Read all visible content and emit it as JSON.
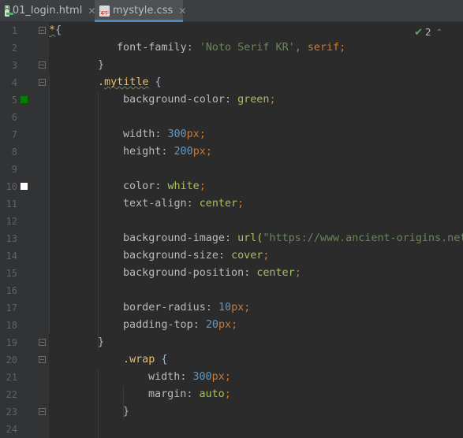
{
  "tabs": [
    {
      "label": "01_login.html",
      "icon": "html-file-icon",
      "icon_text": "H",
      "active": false
    },
    {
      "label": "mystyle.css",
      "icon": "css-file-icon",
      "icon_text": "CSS",
      "active": true
    }
  ],
  "inspection": {
    "icon": "check-icon",
    "count": "2"
  },
  "line_numbers": [
    "1",
    "2",
    "3",
    "4",
    "5",
    "6",
    "7",
    "8",
    "9",
    "10",
    "11",
    "12",
    "13",
    "14",
    "15",
    "16",
    "17",
    "18",
    "19",
    "20",
    "21",
    "22",
    "23",
    "24"
  ],
  "color_markers": {
    "line5": "#008000",
    "line10": "#ffffff"
  },
  "code": {
    "l1": {
      "sel": "*",
      "brace": "{"
    },
    "l2": {
      "prop": "font-family",
      "colon": ": ",
      "str": "'Noto Serif KR'",
      "comma": ", ",
      "kw": "serif",
      "semi": ";"
    },
    "l3": {
      "brace": "}"
    },
    "l4": {
      "dot": ".",
      "cls": "mytitle",
      "brace": " {"
    },
    "l5": {
      "prop": "background-color",
      "colon": ": ",
      "val": "green",
      "semi": ";"
    },
    "l7": {
      "prop": "width",
      "colon": ": ",
      "num": "300",
      "unit": "px",
      "semi": ";"
    },
    "l8": {
      "prop": "height",
      "colon": ": ",
      "num": "200",
      "unit": "px",
      "semi": ";"
    },
    "l10": {
      "prop": "color",
      "colon": ": ",
      "val": "white",
      "semi": ";"
    },
    "l11": {
      "prop": "text-align",
      "colon": ": ",
      "val": "center",
      "semi": ";"
    },
    "l13": {
      "prop": "background-image",
      "colon": ": ",
      "fn": "url(",
      "str": "\"https://www.ancient-origins.net"
    },
    "l14": {
      "prop": "background-size",
      "colon": ": ",
      "val": "cover",
      "semi": ";"
    },
    "l15": {
      "prop": "background-position",
      "colon": ": ",
      "val": "center",
      "semi": ";"
    },
    "l17": {
      "prop": "border-radius",
      "colon": ": ",
      "num": "10",
      "unit": "px",
      "semi": ";"
    },
    "l18": {
      "prop": "padding-top",
      "colon": ": ",
      "num": "20",
      "unit": "px",
      "semi": ";"
    },
    "l19": {
      "brace": "}"
    },
    "l20": {
      "dot": ".",
      "cls": "wrap",
      "brace": " {"
    },
    "l21": {
      "prop": "width",
      "colon": ": ",
      "num": "300",
      "unit": "px",
      "semi": ";"
    },
    "l22": {
      "prop": "margin",
      "colon": ": ",
      "val": "auto",
      "semi": ";"
    },
    "l23": {
      "brace": "}"
    }
  }
}
